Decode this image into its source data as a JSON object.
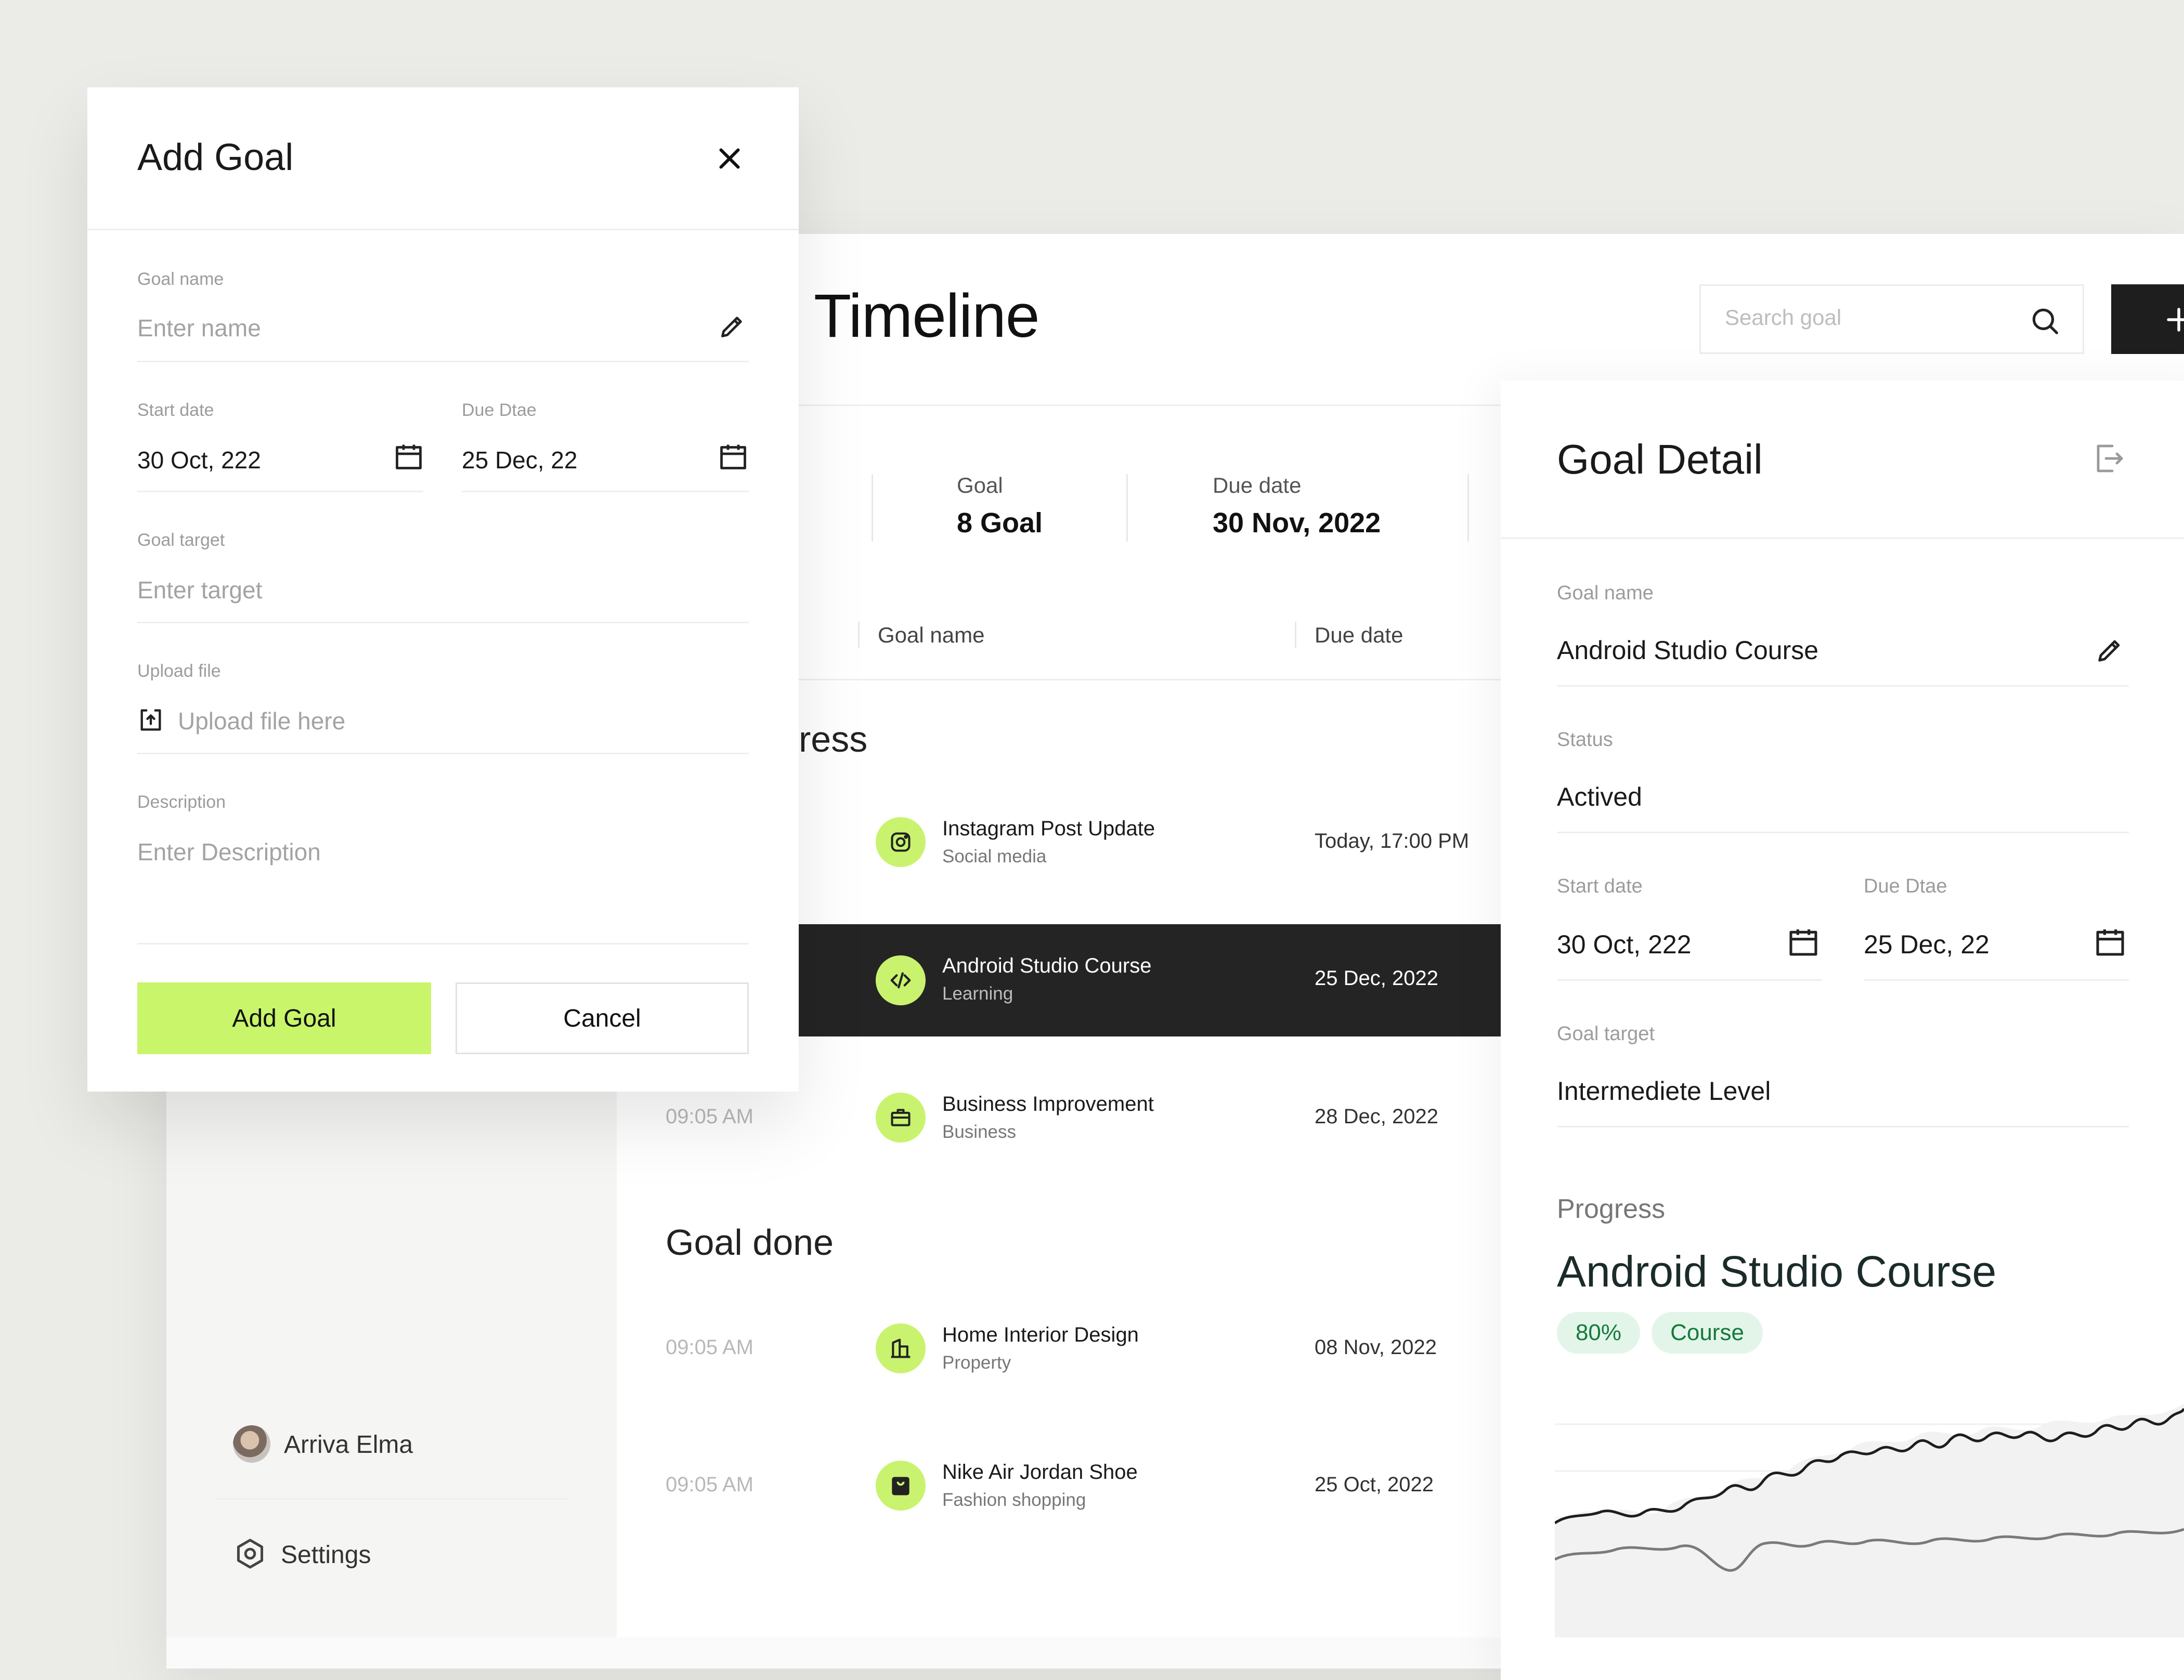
{
  "modal": {
    "title": "Add Goal",
    "goal_name": {
      "label": "Goal name",
      "placeholder": "Enter name"
    },
    "start_date": {
      "label": "Start date",
      "value": "30 Oct, 222"
    },
    "due_date": {
      "label": "Due Dtae",
      "value": "25 Dec, 22"
    },
    "goal_target": {
      "label": "Goal target",
      "placeholder": "Enter target"
    },
    "upload": {
      "label": "Upload file",
      "placeholder": "Upload file here"
    },
    "description": {
      "label": "Description",
      "placeholder": "Enter Description"
    },
    "add_button": "Add Goal",
    "cancel_button": "Cancel"
  },
  "header": {
    "title": "Timeline",
    "search_placeholder": "Search goal"
  },
  "stats": {
    "goal_label": "Goal",
    "goal_value": "8 Goal",
    "due_label": "Due date",
    "due_value": "30 Nov, 2022"
  },
  "table": {
    "col_goal_name": "Goal name",
    "col_due_date": "Due date"
  },
  "sections": {
    "in_progress": "ress",
    "done": "Goal done"
  },
  "rows": [
    {
      "time": "",
      "title": "Instagram Post Update",
      "category": "Social media",
      "due": "Today, 17:00 PM",
      "icon": "instagram-icon"
    },
    {
      "time": "",
      "title": "Android Studio Course",
      "category": "Learning",
      "due": "25 Dec, 2022",
      "icon": "code-icon"
    },
    {
      "time": "09:05 AM",
      "title": "Business Improvement",
      "category": "Business",
      "due": "28 Dec, 2022",
      "icon": "briefcase-icon"
    },
    {
      "time": "09:05 AM",
      "title": "Home Interior Design",
      "category": "Property",
      "due": "08 Nov, 2022",
      "icon": "building-icon"
    },
    {
      "time": "09:05 AM",
      "title": "Nike Air Jordan Shoe",
      "category": "Fashion shopping",
      "due": "25 Oct, 2022",
      "icon": "shopping-bag-icon"
    }
  ],
  "sidebar": {
    "user_name": "Arriva Elma",
    "settings_label": "Settings"
  },
  "detail": {
    "title": "Goal Detail",
    "goal_name_label": "Goal name",
    "goal_name_value": "Android Studio Course",
    "status_label": "Status",
    "status_value": "Actived",
    "start_label": "Start date",
    "start_value": "30 Oct, 222",
    "due_label": "Due Dtae",
    "due_value": "25 Dec, 22",
    "target_label": "Goal target",
    "target_value": "Intermediete Level",
    "progress_label": "Progress",
    "progress_title": "Android Studio Course",
    "progress_percent": "80%",
    "progress_tag": "Course"
  },
  "colors": {
    "accent": "#c8f56a",
    "dark": "#242424",
    "tag_bg": "#e3f5e9",
    "tag_text": "#157a3c"
  }
}
